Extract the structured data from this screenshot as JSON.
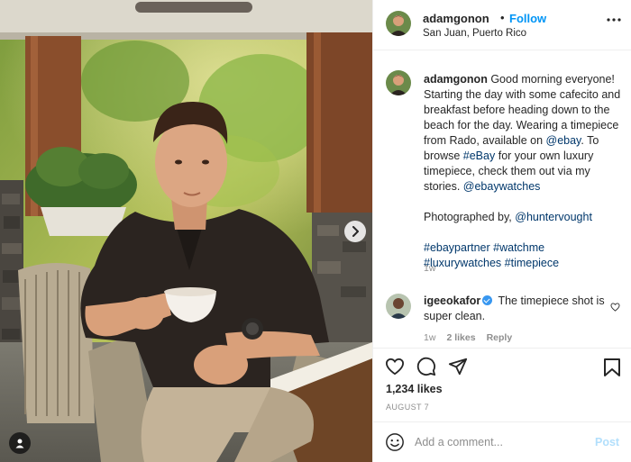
{
  "header": {
    "username": "adamgonon",
    "separator": "•",
    "follow_label": "Follow",
    "location": "San Juan, Puerto Rico",
    "more_icon": "more-options-icon"
  },
  "caption": {
    "username": "adamgonon",
    "text_1": "Good morning everyone! Starting the day with some cafecito and breakfast before heading down to the beach for the day. Wearing a timepiece from Rado, available on",
    "mention_ebay": "@ebay",
    "text_2": ". To browse",
    "hashtag_ebay": "#eBay",
    "text_3": "for your own luxury timepiece, check them out via my stories.",
    "mention_ebaywatches": "@ebaywatches",
    "photo_credit_prefix": "Photographed by,",
    "mention_photographer": "@huntervought",
    "hashtags": [
      "#ebaypartner",
      "#watchme",
      "#luxurywatches",
      "#timepiece"
    ],
    "time": "1w"
  },
  "comment": {
    "username": "igeeokafor",
    "verified": true,
    "text": "The timepiece shot is super clean.",
    "time": "1w",
    "likes": "2 likes",
    "reply_label": "Reply"
  },
  "actions": {
    "icons": [
      "heart-icon",
      "comment-icon",
      "share-icon",
      "bookmark-icon"
    ],
    "likes_count": "1,234 likes",
    "date": "AUGUST 7"
  },
  "composer": {
    "placeholder": "Add a comment...",
    "post_label": "Post",
    "icon": "emoji-icon"
  },
  "media": {
    "next_icon": "chevron-right-icon",
    "tag_icon": "user-tag-icon"
  },
  "colors": {
    "accent": "#0095f6",
    "link": "#00376b",
    "muted": "#8e8e8e",
    "post_disabled": "#b2dffc"
  }
}
